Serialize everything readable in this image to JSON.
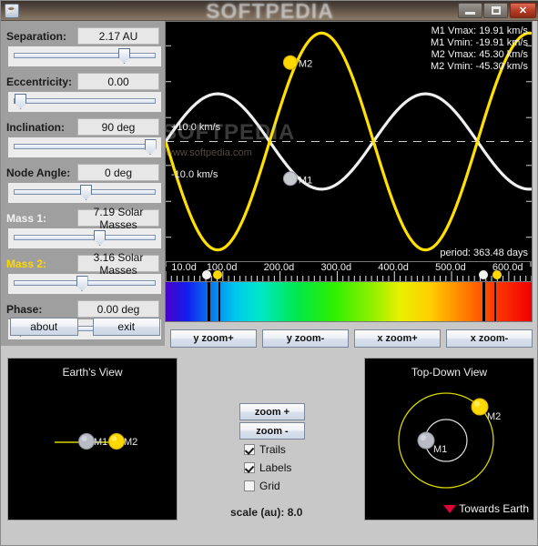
{
  "window": {
    "watermark": "SOFTPEDIA",
    "app_icon": "java-coffee-icon",
    "minimize_label": "Minimize",
    "maximize_label": "Maximize",
    "close_label": "✕"
  },
  "controls": [
    {
      "label": "Separation:",
      "value": "2.17 AU",
      "slider_pct": 78,
      "label_color": "#1b1b1b",
      "style": "dark"
    },
    {
      "label": "Eccentricity:",
      "value": "0.00",
      "slider_pct": 2,
      "label_color": "#1b1b1b",
      "style": "dark"
    },
    {
      "label": "Inclination:",
      "value": "90 deg",
      "slider_pct": 97,
      "label_color": "#1b1b1b",
      "style": "dark"
    },
    {
      "label": "Node Angle:",
      "value": "0 deg",
      "slider_pct": 50,
      "label_color": "#1b1b1b",
      "style": "dark"
    },
    {
      "label": "Mass 1:",
      "value": "7.19 Solar Masses",
      "slider_pct": 60,
      "label_color": "#f2f2f2",
      "style": "white"
    },
    {
      "label": "Mass 2:",
      "value": "3.16 Solar Masses",
      "slider_pct": 47,
      "label_color": "#ffd700",
      "style": "yellow"
    },
    {
      "label": "Phase:",
      "value": "0.00 deg",
      "slider_pct": 2,
      "label_color": "#1b1b1b",
      "style": "dark"
    }
  ],
  "sidebar_buttons": [
    {
      "label": "about"
    },
    {
      "label": "exit"
    }
  ],
  "chart_data": {
    "type": "line",
    "title": "",
    "xlabel": "days",
    "ylabel": "km/s",
    "xtick_labels": [
      "10.0d",
      "100.0d",
      "200.0d",
      "300.0d",
      "400.0d",
      "500.0d",
      "600.0d"
    ],
    "xtick_values": [
      10,
      100,
      200,
      300,
      400,
      500,
      600
    ],
    "xlim": [
      0,
      640
    ],
    "ytick_labels": [
      "+10.0 km/s",
      "-10.0 km/s"
    ],
    "ylim": [
      -50,
      50
    ],
    "grid": false,
    "zero_line": true,
    "legend_position": "none",
    "series": [
      {
        "name": "M1",
        "color": "#f0f0f0",
        "amplitude": 19.91,
        "phase_deg": 0,
        "period_days": 363.48
      },
      {
        "name": "M2",
        "color": "#ffe000",
        "amplitude": 45.3,
        "phase_deg": 180,
        "period_days": 363.48
      }
    ],
    "markers": [
      {
        "name": "M1",
        "color": "#c8c8cf",
        "x_days": 218,
        "y_kms": -15.5
      },
      {
        "name": "M2",
        "color": "#ffd800",
        "x_days": 218,
        "y_kms": 33.0
      }
    ],
    "readouts": [
      "M1 Vmax:  19.91 km/s",
      "M1 Vmin: -19.91 km/s",
      "M2 Vmax:  45.30 km/s",
      "M2 Vmin: -45.30 km/s"
    ],
    "period_text": "period: 363.48 days",
    "watermark": "SOFTPEDIA",
    "watermark_sub": "www.softpedia.com"
  },
  "spectrum": {
    "absorption_lines_pct": [
      11.5,
      14.5,
      86.5,
      89.8
    ]
  },
  "zoom_buttons": [
    {
      "label": "y zoom+"
    },
    {
      "label": "y zoom-"
    },
    {
      "label": "x zoom+"
    },
    {
      "label": "x zoom-"
    }
  ],
  "earth_view": {
    "title": "Earth's View",
    "m1_label": "M1",
    "m2_label": "M2"
  },
  "top_down_view": {
    "title": "Top-Down View",
    "m1_label": "M1",
    "m2_label": "M2",
    "towards_earth_label": "Towards Earth"
  },
  "center_controls": {
    "zoom_in_label": "zoom +",
    "zoom_out_label": "zoom -",
    "checkboxes": [
      {
        "label": "Trails",
        "checked": true
      },
      {
        "label": "Labels",
        "checked": true
      },
      {
        "label": "Grid",
        "checked": false
      }
    ],
    "scale_text": "scale (au): 8.0"
  }
}
